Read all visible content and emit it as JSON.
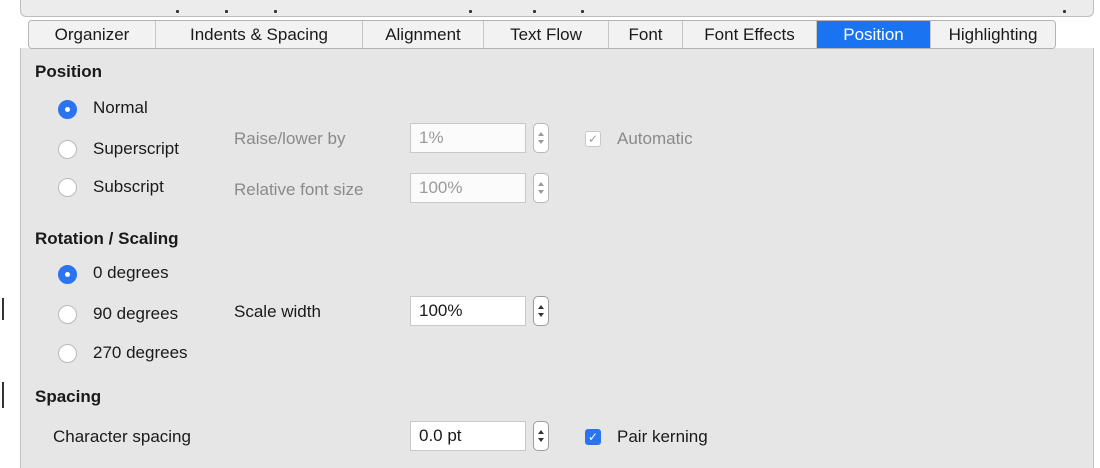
{
  "tabs": [
    {
      "label": "Organizer",
      "active": false
    },
    {
      "label": "Indents & Spacing",
      "active": false
    },
    {
      "label": "Alignment",
      "active": false
    },
    {
      "label": "Text Flow",
      "active": false
    },
    {
      "label": "Font",
      "active": false
    },
    {
      "label": "Font Effects",
      "active": false
    },
    {
      "label": "Position",
      "active": true
    },
    {
      "label": "Highlighting",
      "active": false
    }
  ],
  "position": {
    "heading": "Position",
    "options": [
      {
        "label": "Normal",
        "selected": true
      },
      {
        "label": "Superscript",
        "selected": false
      },
      {
        "label": "Subscript",
        "selected": false
      }
    ],
    "raise_lower_label": "Raise/lower by",
    "raise_lower_value": "1%",
    "relative_size_label": "Relative font size",
    "relative_size_value": "100%",
    "automatic_label": "Automatic",
    "automatic_checked": true
  },
  "rotation": {
    "heading": "Rotation / Scaling",
    "options": [
      {
        "label": "0 degrees",
        "selected": true
      },
      {
        "label": "90 degrees",
        "selected": false
      },
      {
        "label": "270 degrees",
        "selected": false
      }
    ],
    "scale_width_label": "Scale width",
    "scale_width_value": "100%"
  },
  "spacing": {
    "heading": "Spacing",
    "char_spacing_label": "Character spacing",
    "char_spacing_value": "0.0 pt",
    "pair_kerning_label": "Pair kerning",
    "pair_kerning_checked": true
  },
  "colors": {
    "accent": "#1a73f0",
    "panel_bg": "#e6e6e6"
  }
}
